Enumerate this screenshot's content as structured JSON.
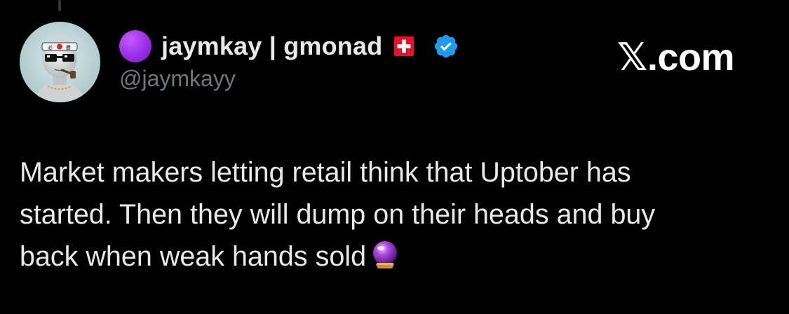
{
  "tweet": {
    "author": {
      "display_name": "jaymkay | gmonad",
      "handle": "@jaymkayy",
      "status_icon": "purple-circle-icon",
      "flag_icon": "swiss-flag-icon",
      "verified_icon": "verified-badge-icon"
    },
    "site_label": "𝕏.com",
    "text_lines": [
      "Market makers letting retail think that Uptober has",
      "started. Then they will dump on their heads and buy",
      "back when weak hands sold"
    ],
    "trailing_emoji": "crystal-ball-icon"
  },
  "colors": {
    "background": "#000000",
    "primary_text": "#e7e9ea",
    "secondary_text": "#71767b",
    "verified_blue": "#1d9bf0",
    "status_purple": "#9a2de6",
    "flag_red": "#e8112d"
  }
}
